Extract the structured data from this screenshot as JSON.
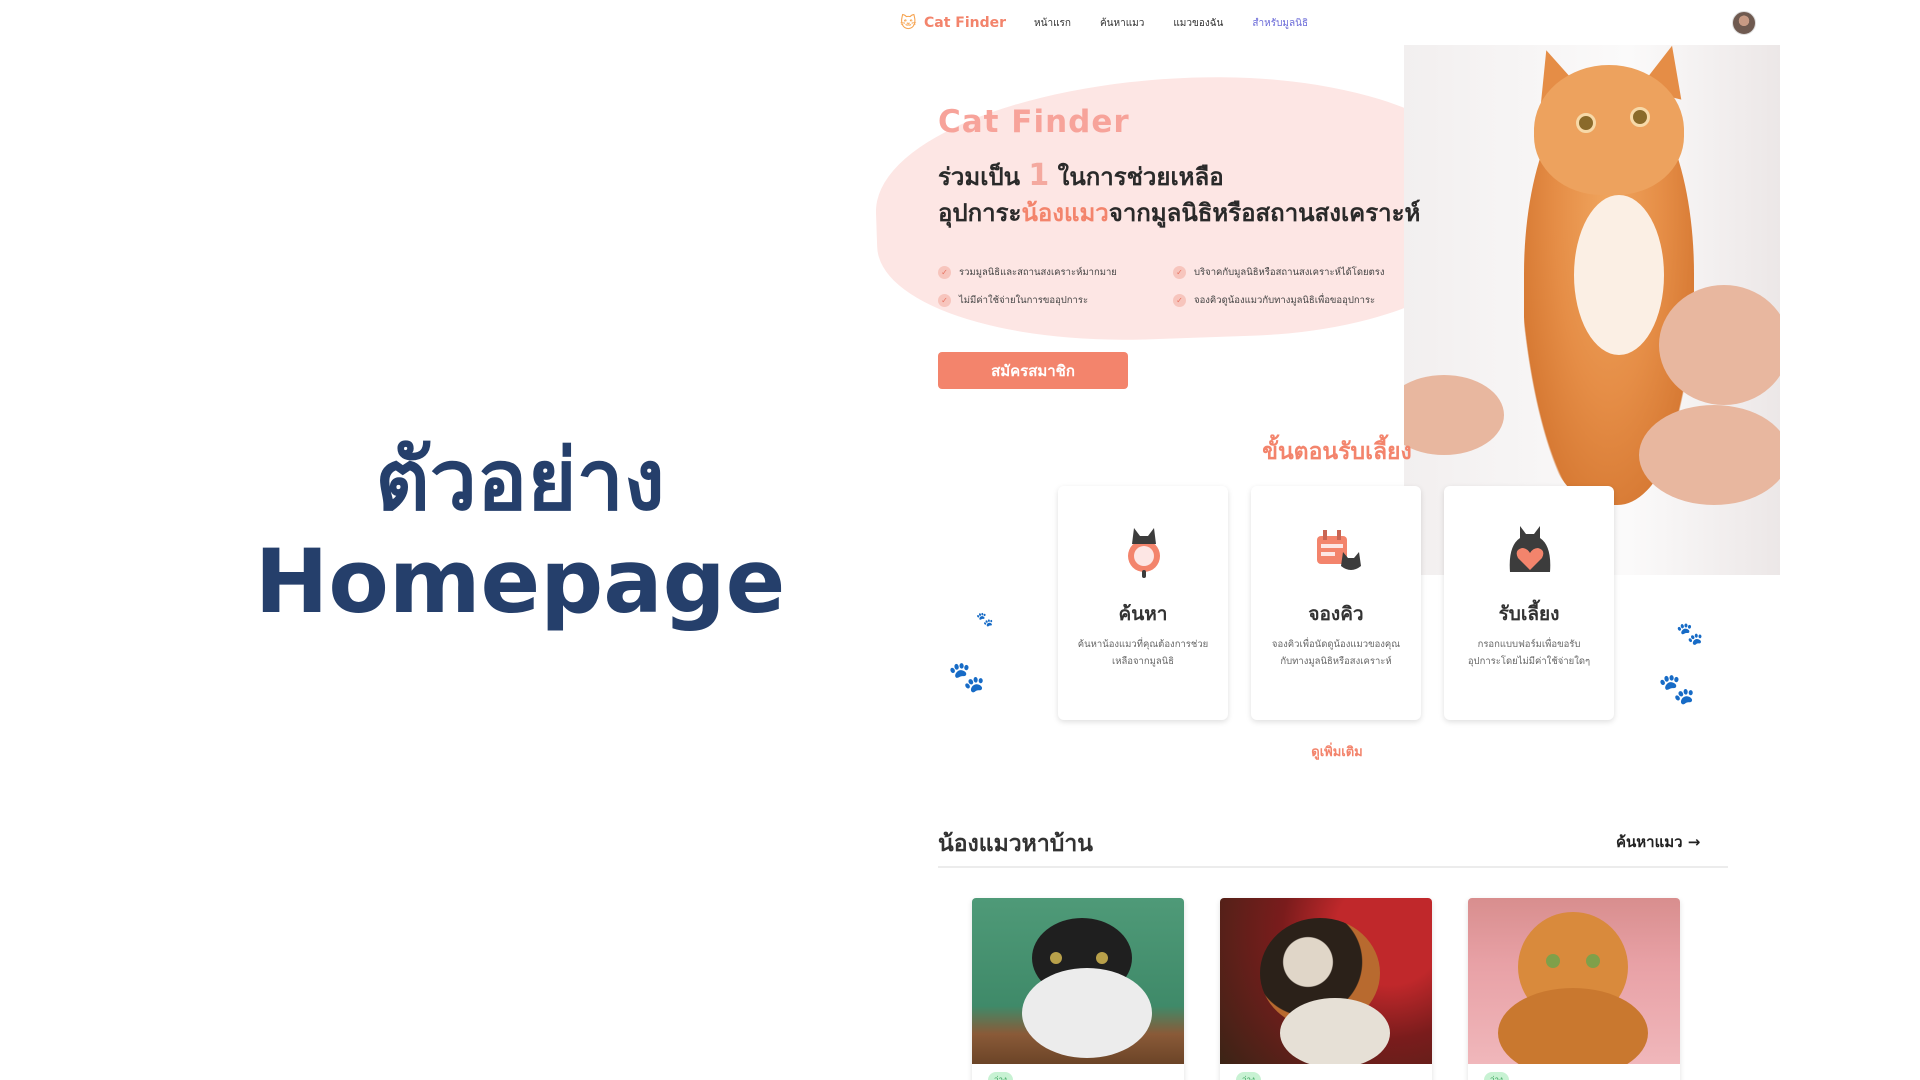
{
  "caption": {
    "line1": "ตัวอย่าง",
    "line2": "Homepage"
  },
  "nav": {
    "brand": "Cat Finder",
    "links": [
      "หน้าแรก",
      "ค้นหาแมว",
      "แมวของฉัน",
      "สำหรับมูลนิธิ"
    ],
    "active_index": 3
  },
  "hero": {
    "brand": "Cat Finder",
    "title_part1": "ร่วมเป็น ",
    "title_num": "1",
    "title_part2": " ในการช่วยเหลือ",
    "title_line2_prefix": "อุปการะ",
    "title_line2_highlight": "น้องแมว",
    "title_line2_suffix": "จากมูลนิธิหรือสถานสงเคราะห์",
    "features": [
      "รวมมูลนิธิและสถานสงเคราะห์มากมาย",
      "บริจาคกับมูลนิธิหรือสถานสงเคราะห์ได้โดยตรง",
      "ไม่มีค่าใช้จ่ายในการขออุปการะ",
      "จองคิวดูน้องแมวกับทางมูลนิธิเพื่อขออุปการะ"
    ],
    "cta_label": "สมัครสมาชิก"
  },
  "steps": {
    "title": "ขั้นตอนรับเลี้ยง",
    "items": [
      {
        "title": "ค้นหา",
        "desc": "ค้นหาน้องแมวที่คุณต้องการช่วยเหลือจากมูลนิธิ",
        "icon": "search-cat-icon"
      },
      {
        "title": "จองคิว",
        "desc": "จองคิวเพื่อนัดดูน้องแมวของคุณกับทางมูลนิธิหรือสงเคราะห์",
        "icon": "calendar-cat-icon"
      },
      {
        "title": "รับเลี้ยง",
        "desc": "กรอกแบบฟอร์มเพื่อขอรับอุปการะโดยไม่มีค่าใช้จ่ายใดๆ",
        "icon": "heart-cat-icon"
      }
    ],
    "more_link": "ดูเพิ่มเติม"
  },
  "cats_section": {
    "title": "น้องแมวหาบ้าน",
    "link": "ค้นหาแมว →",
    "cards": [
      {
        "badge": "ว่าง"
      },
      {
        "badge": "ว่าง"
      },
      {
        "badge": "ว่าง"
      }
    ]
  },
  "colors": {
    "accent": "#f3846c",
    "accent_light": "#fde6e4",
    "caption": "#253f6b",
    "nav_active": "#6b6bd8",
    "badge_bg": "#c8f2d3"
  }
}
